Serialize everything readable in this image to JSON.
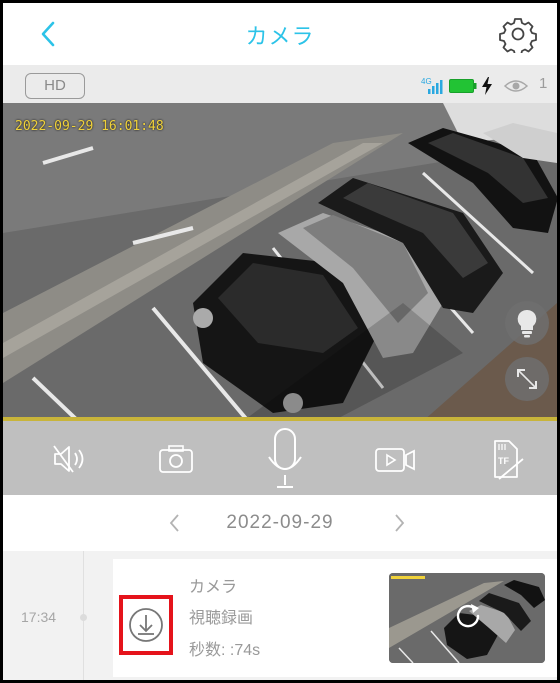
{
  "header": {
    "title": "カメラ",
    "back_icon": "chevron-left-icon",
    "settings_icon": "gear-icon",
    "accent_color": "#2cc3e8"
  },
  "status": {
    "quality_label": "HD",
    "network_label": "4G",
    "viewer_count": "1",
    "battery_color": "#22c334"
  },
  "video": {
    "timestamp": "2022-09-29 16:01:48",
    "timestamp_color": "#f0d23a"
  },
  "controls": [
    {
      "name": "mute",
      "icon": "speaker-muted-icon"
    },
    {
      "name": "snapshot",
      "icon": "camera-icon"
    },
    {
      "name": "talk",
      "icon": "microphone-icon"
    },
    {
      "name": "record",
      "icon": "video-record-icon"
    },
    {
      "name": "tf-card",
      "icon": "sd-card-icon"
    }
  ],
  "date_nav": {
    "date": "2022-09-29",
    "prev_icon": "chevron-left-icon",
    "next_icon": "chevron-right-icon"
  },
  "recordings": [
    {
      "time": "17:34",
      "camera_name": "カメラ",
      "type": "視聴録画",
      "duration": "秒数: :74s",
      "download_icon": "download-icon",
      "highlight_color": "#e5131b"
    }
  ]
}
